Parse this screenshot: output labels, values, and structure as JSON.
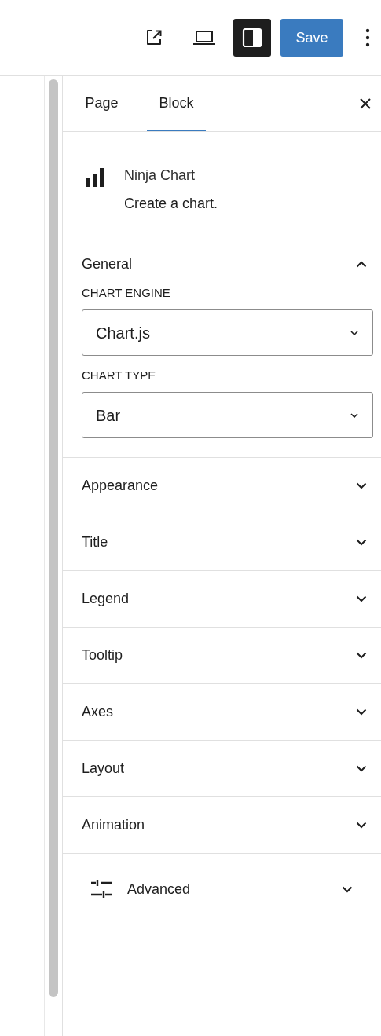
{
  "toolbar": {
    "save_label": "Save",
    "sidebar_toggle_pressed": true
  },
  "tabs": [
    {
      "label": "Page",
      "selected": false
    },
    {
      "label": "Block",
      "selected": true
    }
  ],
  "block": {
    "name": "Ninja Chart",
    "description": "Create a chart."
  },
  "panels": [
    {
      "kind": "section",
      "title": "General",
      "expanded": true,
      "fields": [
        {
          "label": "CHART ENGINE",
          "value": "Chart.js"
        },
        {
          "label": "CHART TYPE",
          "value": "Bar"
        }
      ]
    },
    {
      "kind": "section",
      "title": "Appearance",
      "expanded": false
    },
    {
      "kind": "section",
      "title": "Title",
      "expanded": false
    },
    {
      "kind": "section",
      "title": "Legend",
      "expanded": false
    },
    {
      "kind": "section",
      "title": "Tooltip",
      "expanded": false
    },
    {
      "kind": "section",
      "title": "Axes",
      "expanded": false
    },
    {
      "kind": "section",
      "title": "Layout",
      "expanded": false
    },
    {
      "kind": "section",
      "title": "Animation",
      "expanded": false
    },
    {
      "kind": "advanced",
      "title": "Advanced",
      "expanded": false
    }
  ]
}
